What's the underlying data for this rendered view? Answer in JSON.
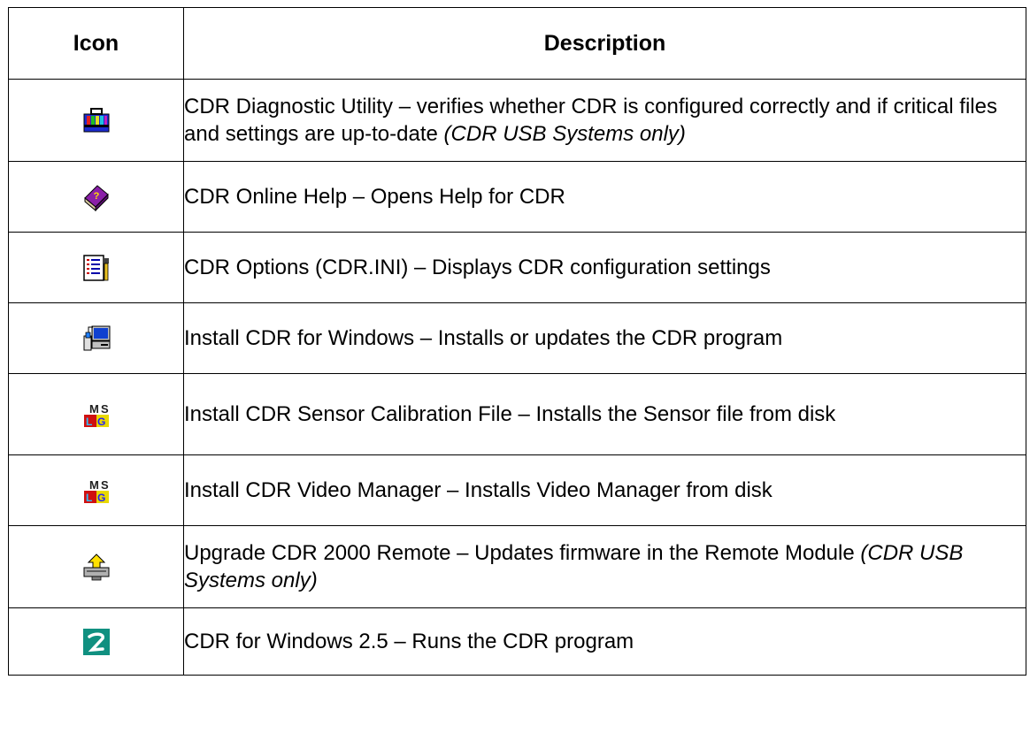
{
  "table": {
    "header": {
      "icon": "Icon",
      "description": "Description"
    },
    "rows": [
      {
        "icon": "toolbox-icon",
        "text": "CDR Diagnostic Utility – verifies whether CDR is configured correctly and if critical files and settings are up-to-date ",
        "note": "(CDR USB Systems only)"
      },
      {
        "icon": "help-book-icon",
        "text": "CDR Online Help – Opens Help for CDR",
        "note": ""
      },
      {
        "icon": "ini-settings-icon",
        "text": "CDR Options (CDR.INI) – Displays CDR configuration settings",
        "note": ""
      },
      {
        "icon": "computer-install-icon",
        "text": "Install CDR for Windows – Installs or updates the CDR program",
        "note": ""
      },
      {
        "icon": "ms-setup-icon",
        "text": "Install CDR Sensor Calibration File – Installs the Sensor file from disk",
        "note": ""
      },
      {
        "icon": "ms-setup-icon",
        "text": "Install CDR Video Manager – Installs Video Manager from disk",
        "note": ""
      },
      {
        "icon": "upgrade-arrow-icon",
        "text": "Upgrade CDR 2000 Remote – Updates firmware in the Remote Module ",
        "note": "(CDR USB Systems only)"
      },
      {
        "icon": "cdr-logo-icon",
        "text": "CDR for Windows 2.5 – Runs the CDR program",
        "note": ""
      }
    ]
  },
  "colors": {
    "border": "#000000",
    "text": "#000000",
    "background": "#ffffff"
  }
}
